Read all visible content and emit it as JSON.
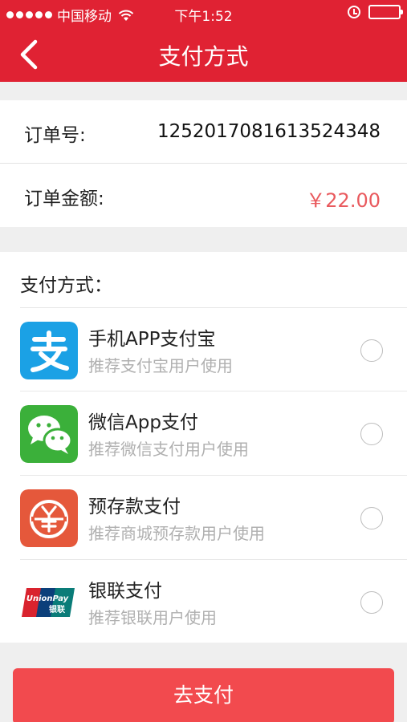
{
  "status_bar": {
    "carrier": "中国移动",
    "time": "下午1:52"
  },
  "nav": {
    "title": "支付方式"
  },
  "order": {
    "number_label": "订单号:",
    "number_value": "1252017081613524348",
    "amount_label": "订单金额:",
    "amount_value": "￥22.00"
  },
  "payment": {
    "heading": "支付方式：",
    "methods": [
      {
        "name": "手机APP支付宝",
        "desc": "推荐支付宝用户使用",
        "icon": "alipay-icon",
        "selected": false
      },
      {
        "name": "微信App支付",
        "desc": "推荐微信支付用户使用",
        "icon": "wechat-icon",
        "selected": false
      },
      {
        "name": "预存款支付",
        "desc": "推荐商城预存款用户使用",
        "icon": "deposit-icon",
        "selected": false
      },
      {
        "name": "银联支付",
        "desc": "推荐银联用户使用",
        "icon": "unionpay-icon",
        "selected": false
      }
    ]
  },
  "action": {
    "pay_label": "去支付"
  },
  "colors": {
    "brand_red": "#e02233",
    "button_red": "#f24a4e",
    "amount_red": "#e95a5e",
    "alipay_blue": "#1ba1e5",
    "wechat_green": "#3bb03a",
    "deposit_orange": "#e5583b"
  }
}
